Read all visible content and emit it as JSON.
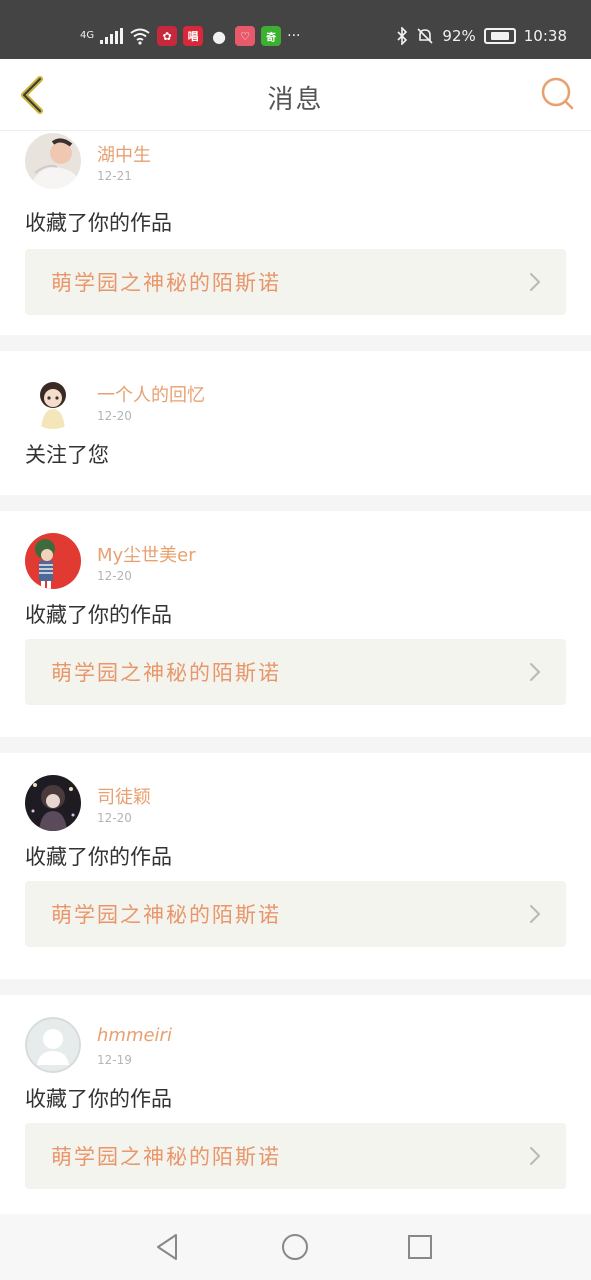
{
  "status_bar": {
    "network": "4G",
    "app_icons": [
      {
        "name": "huawei-icon",
        "glyph": "✿",
        "color": "#c8283c"
      },
      {
        "name": "changba-icon",
        "glyph": "唱",
        "color": "#d8283a"
      },
      {
        "name": "wechat-icon",
        "glyph": "●",
        "color": "#444444"
      },
      {
        "name": "app-pink-icon",
        "glyph": "♡",
        "color": "#e85a6a"
      },
      {
        "name": "iqiyi-icon",
        "glyph": "奇",
        "color": "#3cb030"
      }
    ],
    "more": "···",
    "battery": "92%",
    "time": "10:38"
  },
  "header": {
    "title": "消息",
    "back_icon": "chevron-left-icon",
    "search_icon": "search-icon",
    "accent_color": "#e8a070"
  },
  "messages": [
    {
      "username": "湖中生",
      "date": "12-21",
      "action": "收藏了你的作品",
      "work": "萌学园之神秘的陌斯诺"
    },
    {
      "username": "一个人的回忆",
      "date": "12-20",
      "action": "关注了您"
    },
    {
      "username": "My尘世美er",
      "date": "12-20",
      "action": "收藏了你的作品",
      "work": "萌学园之神秘的陌斯诺"
    },
    {
      "username": "司徒颖",
      "date": "12-20",
      "action": "收藏了你的作品",
      "work": "萌学园之神秘的陌斯诺"
    },
    {
      "username": "hmmeiri",
      "date": "12-19",
      "action": "收藏了你的作品",
      "work": "萌学园之神秘的陌斯诺"
    }
  ],
  "navbar": {
    "back": "triangle-back-icon",
    "home": "circle-home-icon",
    "recents": "square-recents-icon"
  }
}
